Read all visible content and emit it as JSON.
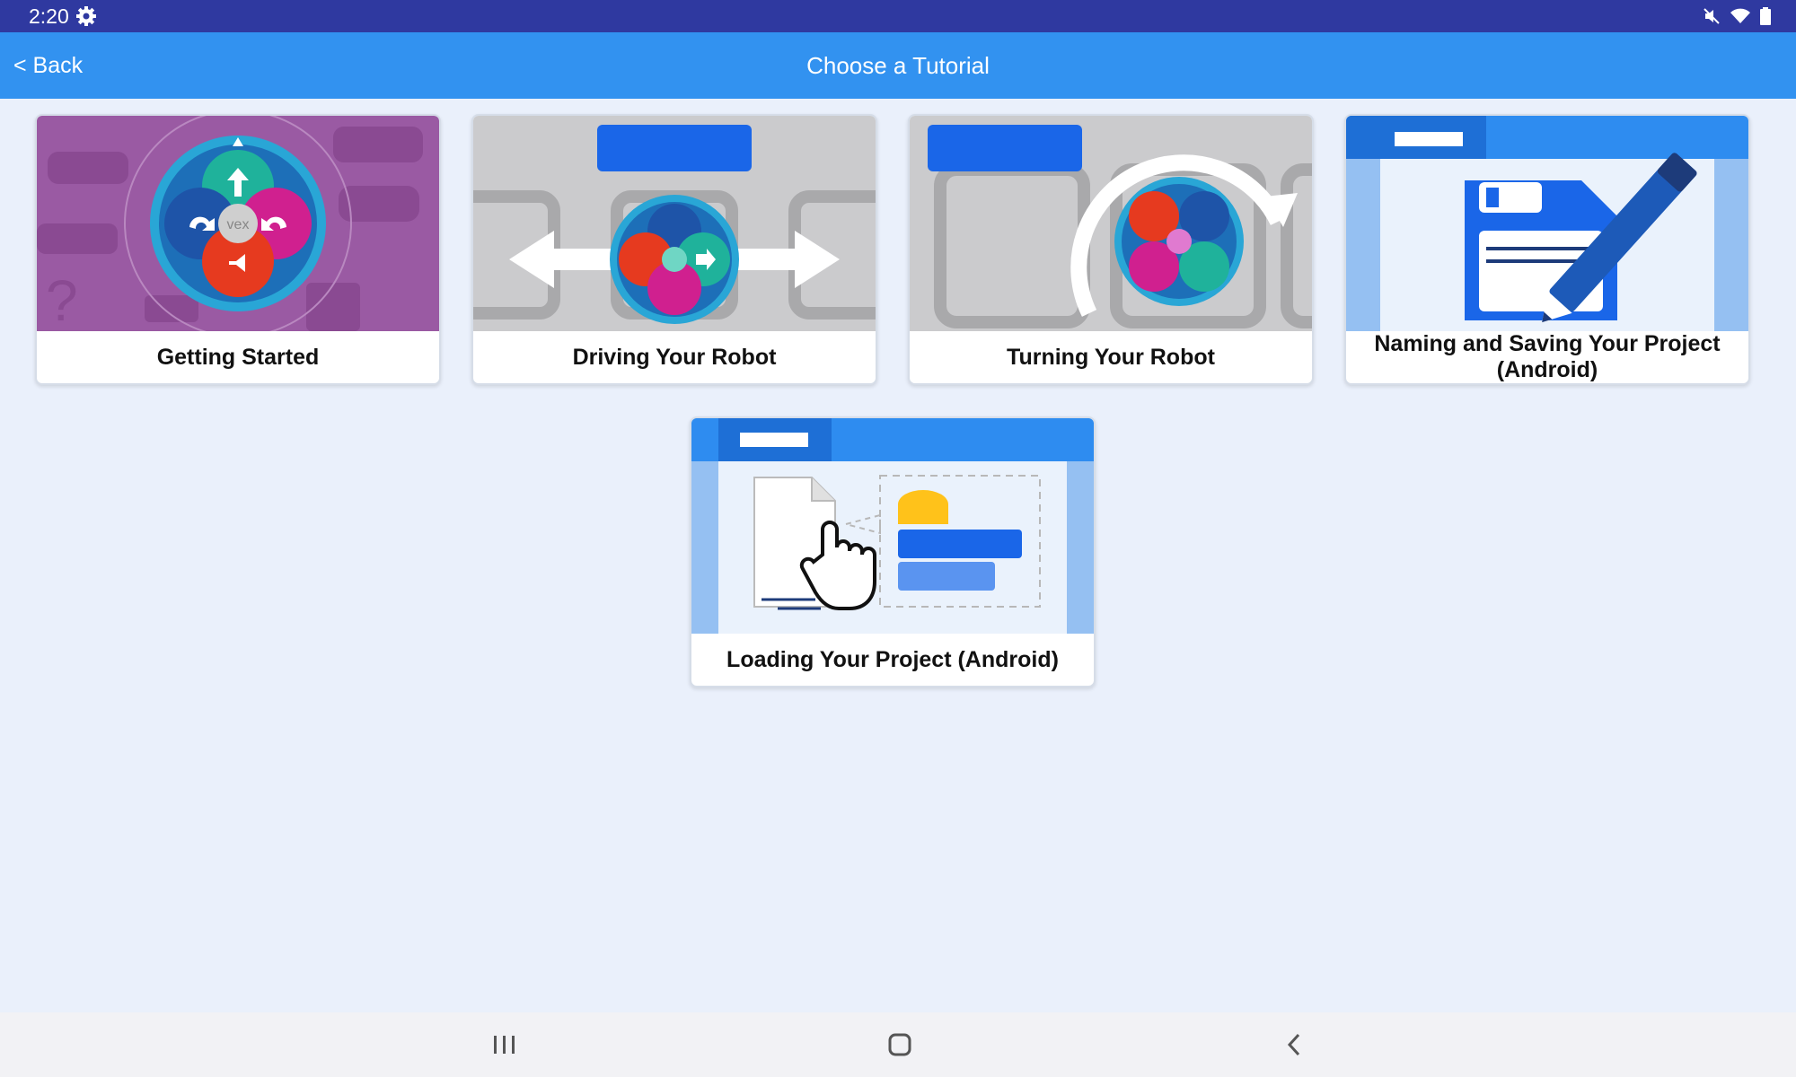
{
  "status_bar": {
    "time": "2:20",
    "icons": [
      "settings-gear-icon",
      "mute-icon",
      "wifi-icon",
      "battery-icon"
    ]
  },
  "app_bar": {
    "back_label": "< Back",
    "title": "Choose a Tutorial"
  },
  "tutorials": [
    {
      "label": "Getting Started",
      "image": "vex-controller-purple-icon"
    },
    {
      "label": "Driving Your Robot",
      "image": "drive-arrows-icon"
    },
    {
      "label": "Turning Your Robot",
      "image": "turn-arrow-icon"
    },
    {
      "label": "Naming and Saving Your Project (Android)",
      "image": "save-pencil-icon"
    },
    {
      "label": "Loading Your Project (Android)",
      "image": "load-document-icon"
    }
  ],
  "nav_bar": {
    "buttons": [
      "recents-icon",
      "home-icon",
      "back-icon"
    ]
  },
  "colors": {
    "status_bar": "#2f39a0",
    "app_bar": "#3292f0",
    "background": "#eaf0fb"
  }
}
